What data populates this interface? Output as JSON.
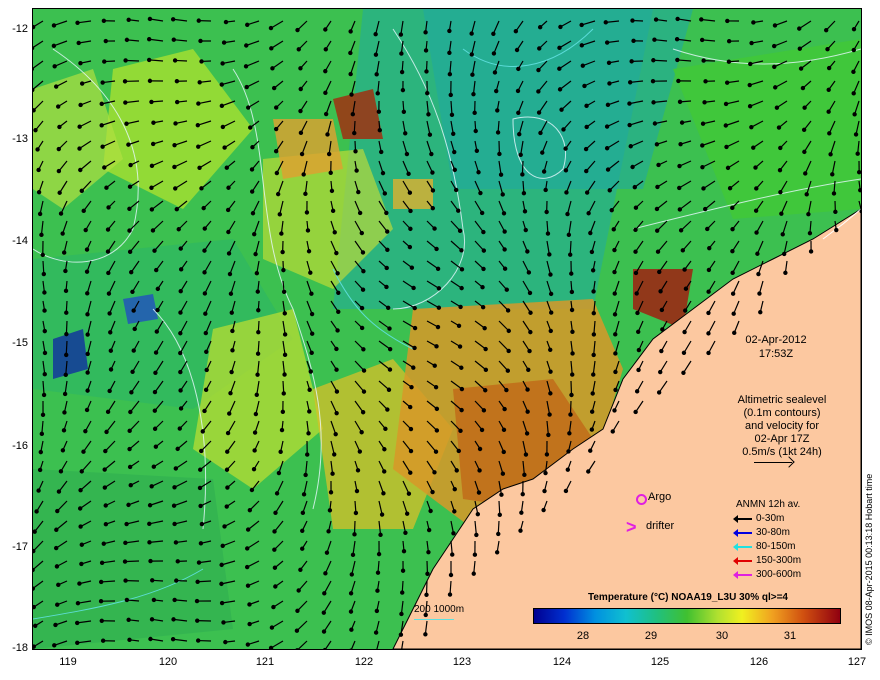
{
  "map": {
    "datetime": "02-Apr-2012",
    "time": "17:53Z",
    "altimetry_note": [
      "Altimetric sealevel",
      "(0.1m contours)",
      "and velocity for",
      "02-Apr 17Z",
      "0.5m/s (1kt 24h)"
    ],
    "argo_label": "Argo",
    "drifter_label": "drifter",
    "legend_title": "ANMN 12h av.",
    "legend_items": [
      {
        "label": "0-30m",
        "color": "#000000"
      },
      {
        "label": "30-80m",
        "color": "#0000e0"
      },
      {
        "label": "80-150m",
        "color": "#20e0e0"
      },
      {
        "label": "150-300m",
        "color": "#e00000"
      },
      {
        "label": "300-600m",
        "color": "#e020e0"
      }
    ],
    "colorbar_title": "Temperature (°C) NOAA19_L3U 30% ql>=4",
    "colorbar_ticks": [
      "28",
      "29",
      "30",
      "31"
    ],
    "isobath_label": "200  1000m",
    "credit": "© IMOS 08-Apr-2015 00:13:18 Hobart time",
    "y_ticks": [
      "-12",
      "-13",
      "-14",
      "-15",
      "-16",
      "-17",
      "-18"
    ],
    "x_ticks": [
      "119",
      "120",
      "121",
      "122",
      "123",
      "124",
      "125",
      "126",
      "127"
    ]
  }
}
